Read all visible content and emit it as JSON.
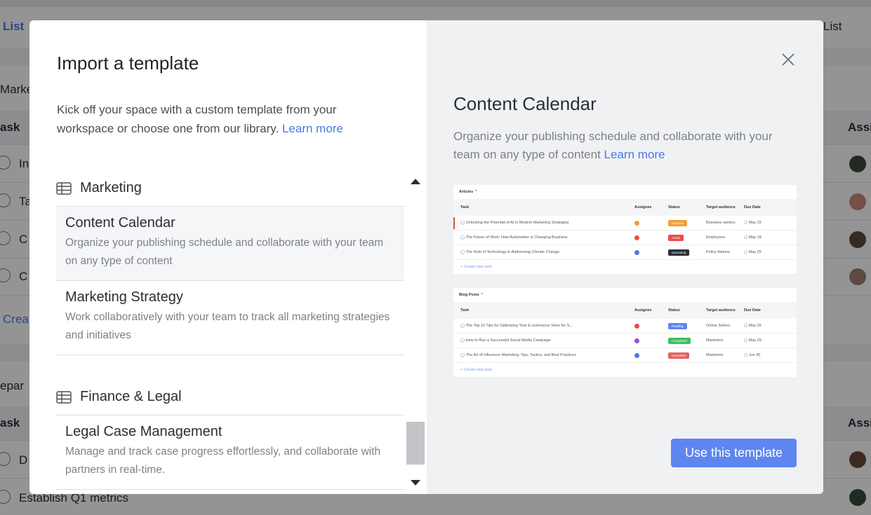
{
  "background": {
    "tab_list": "List",
    "tab_list_right": "List",
    "section1": "Marke",
    "col_task": "ask",
    "col_assignee": "Assi",
    "rows1": [
      "In",
      "Ta",
      "C",
      "C"
    ],
    "create": "Crea",
    "section2": "epar",
    "col_task2": "ask",
    "col_assignee2": "Assi",
    "rows2": [
      "D",
      "Establish Q1 metrics"
    ]
  },
  "modal": {
    "title": "Import a template",
    "intro": "Kick off your space with a custom template from your workspace or choose one from our library.",
    "intro_link": "Learn more",
    "categories": [
      {
        "name": "Marketing",
        "items": [
          {
            "title": "Content Calendar",
            "desc": "Organize your publishing schedule and collaborate with your team on any type of content"
          },
          {
            "title": "Marketing Strategy",
            "desc": "Work collaboratively with your team to track all marketing strategies and initiatives"
          }
        ]
      },
      {
        "name": "Finance & Legal",
        "items": [
          {
            "title": "Legal Case Management",
            "desc": "Manage and track case progress effortlessly, and collaborate with partners in real-time."
          }
        ]
      }
    ],
    "preview": {
      "title": "Content Calendar",
      "desc": "Organize your publishing schedule and collaborate with your team on any type of content",
      "desc_link": "Learn more",
      "tables": [
        {
          "heading": "Articles",
          "columns": [
            "Task",
            "Assignee",
            "Status",
            "Target audience",
            "Due Date"
          ],
          "rows": [
            {
              "task": "Unlocking the Potential of AI in Modern Marketing Strategies",
              "status": "Overdue",
              "status_color": "#f0a030",
              "audience": "Business owners",
              "due": "May 15",
              "avatar_color": "#f0a030"
            },
            {
              "task": "The Future of Work: How Automation is Changing Business",
              "status": "Active",
              "status_color": "#e84c4c",
              "audience": "Employees",
              "due": "May 18",
              "avatar_color": "#e84c4c"
            },
            {
              "task": "The Role of Technology in Addressing Climate Change",
              "status": "Upcoming",
              "status_color": "#2a2e34",
              "audience": "Policy Makers",
              "due": "May 25",
              "avatar_color": "#4a78e8"
            }
          ],
          "create": "+ Create new task"
        },
        {
          "heading": "Blog Posts",
          "columns": [
            "Task",
            "Assignee",
            "Status",
            "Target audience",
            "Due Date"
          ],
          "rows": [
            {
              "task": "The Top 10 Tips for Optimizing Your E-commerce Store for S...",
              "status": "Pending",
              "status_color": "#5f86f0",
              "audience": "Online Sellers",
              "due": "May 26",
              "avatar_color": "#e84c4c"
            },
            {
              "task": "How to Run a Successful Social Media Campaign",
              "status": "Completed",
              "status_color": "#3cbf5a",
              "audience": "Marketers",
              "due": "May 29",
              "avatar_color": "#9b4fd0"
            },
            {
              "task": "The Art of Influencer Marketing: Tips, Tactics, and Best Practices",
              "status": "Cancelled",
              "status_color": "#e86060",
              "audience": "Marketers",
              "due": "Jun 30",
              "avatar_color": "#4a78e8"
            }
          ],
          "create": "+ Create new task"
        }
      ]
    },
    "use_button": "Use this template"
  }
}
